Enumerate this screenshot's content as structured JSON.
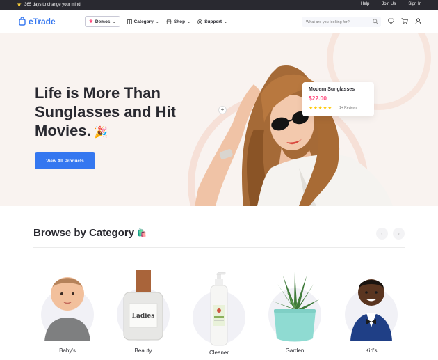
{
  "topbar": {
    "promo": "365 days to change your mind",
    "links": {
      "help": "Help",
      "join": "Join Us",
      "signin": "Sign In"
    }
  },
  "header": {
    "logo": "eTrade",
    "nav": {
      "demos": "Demos",
      "category": "Category",
      "shop": "Shop",
      "support": "Support"
    },
    "search_placeholder": "What are you looking for?"
  },
  "hero": {
    "title": "Life is More Than Sunglasses and Hit Movies.",
    "cta": "View All Products",
    "product": {
      "name": "Modern Sunglasses",
      "price": "$22.00",
      "rating": 5,
      "reviews": "1+ Reviews"
    }
  },
  "browse": {
    "title": "Browse by Category",
    "categories": [
      {
        "label": "Baby's"
      },
      {
        "label": "Beauty"
      },
      {
        "label": "Cleaner"
      },
      {
        "label": "Garden"
      },
      {
        "label": "Kid's"
      }
    ]
  },
  "colors": {
    "accent": "#3577f0",
    "price": "#ff497c",
    "dark": "#292930",
    "hero_bg": "#f9f3f0"
  }
}
